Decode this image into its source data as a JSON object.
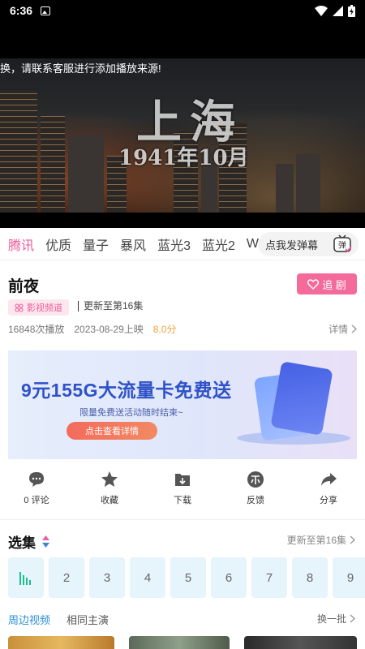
{
  "status_bar": {
    "time": "6:36"
  },
  "video": {
    "notice": "换，请联系客服进行添加播放来源!",
    "title_big": "上海",
    "title_date": "1941年10月"
  },
  "sources": [
    "腾讯",
    "优质",
    "量子",
    "暴风",
    "蓝光3",
    "蓝光2",
    "WPa"
  ],
  "danmaku": {
    "placeholder": "点我发弹幕",
    "icon_text": "弹"
  },
  "show": {
    "title": "前夜",
    "follow_label": "追 剧",
    "channel": "影视频道",
    "update": "更新至第16集",
    "plays": "16848次播放",
    "release": "2023-08-29上映",
    "score": "8.0分",
    "detail_label": "详情"
  },
  "banner": {
    "title": "9元155G大流量卡免费送",
    "subtitle": "限量免费送活动随时结束~",
    "button": "点击查看详情"
  },
  "actions": [
    {
      "label": "0 评论",
      "icon": "comment-icon"
    },
    {
      "label": "收藏",
      "icon": "star-icon"
    },
    {
      "label": "下载",
      "icon": "download-icon"
    },
    {
      "label": "反馈",
      "icon": "feedback-icon"
    },
    {
      "label": "分享",
      "icon": "share-icon"
    }
  ],
  "episodes": {
    "title": "选集",
    "update": "更新至第16集",
    "items": [
      "",
      "2",
      "3",
      "4",
      "5",
      "6",
      "7",
      "8",
      "9"
    ]
  },
  "related": {
    "tabs": [
      "周边视频",
      "相同主演"
    ],
    "more": "换一批"
  },
  "colors": {
    "accent_pink": "#ef5b9c",
    "accent_blue": "#2a8fd8",
    "score": "#f0a23a"
  }
}
